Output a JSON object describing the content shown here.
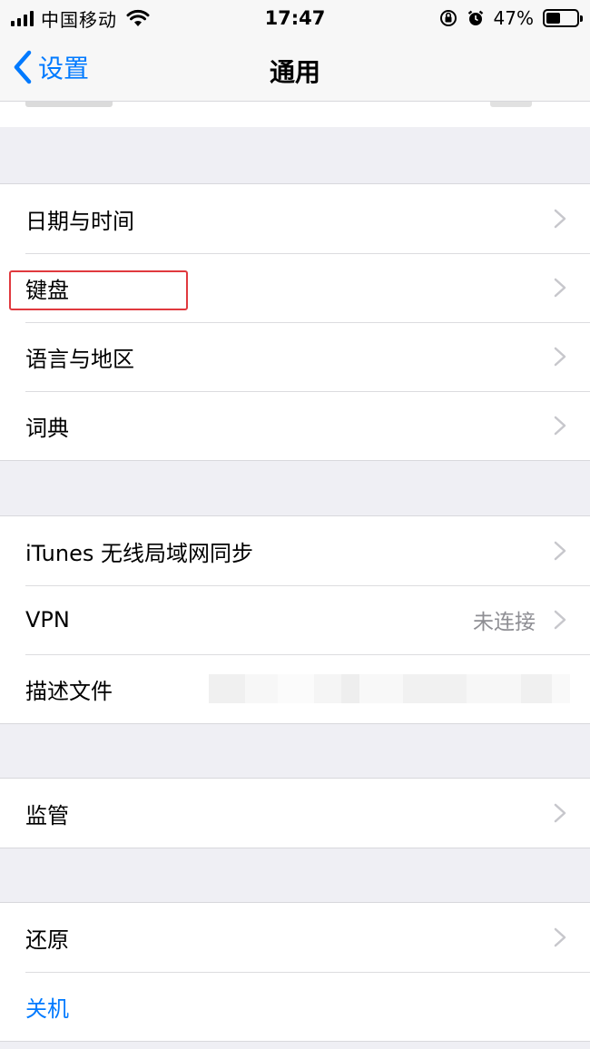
{
  "status_bar": {
    "carrier": "中国移动",
    "time": "17:47",
    "battery_percent": "47%",
    "battery_level": 0.47
  },
  "nav": {
    "back_label": "设置",
    "title": "通用"
  },
  "groups": [
    {
      "items": [
        {
          "label": "日期与时间"
        },
        {
          "label": "键盘"
        },
        {
          "label": "语言与地区"
        },
        {
          "label": "词典"
        }
      ]
    },
    {
      "items": [
        {
          "label": "iTunes 无线局域网同步"
        },
        {
          "label": "VPN",
          "detail": "未连接"
        },
        {
          "label": "描述文件"
        }
      ]
    },
    {
      "items": [
        {
          "label": "监管"
        }
      ]
    },
    {
      "items": [
        {
          "label": "还原"
        },
        {
          "label": "关机"
        }
      ]
    }
  ],
  "colors": {
    "accent": "#007aff",
    "highlight_box": "#e0393e",
    "background": "#efeff4"
  }
}
